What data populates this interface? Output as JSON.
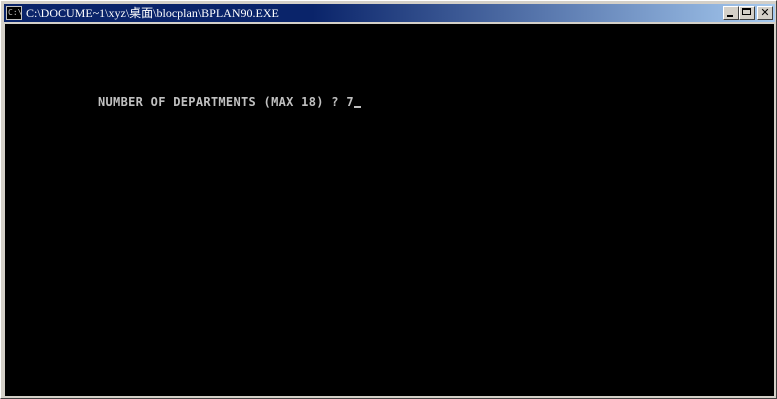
{
  "window": {
    "title": "C:\\DOCUME~1\\xyz\\桌面\\blocplan\\BPLAN90.EXE",
    "icon_name": "console-icon",
    "icon_glyph": "C:\\",
    "minimize_icon": "minimize-icon",
    "maximize_icon": "maximize-icon",
    "close_icon": "close-icon",
    "close_glyph": "✕"
  },
  "console": {
    "background": "#000000",
    "text_color": "#c0c0c0",
    "prompt": "NUMBER OF DEPARTMENTS (MAX 18) ? ",
    "input_value": "7"
  },
  "colors": {
    "titlebar_active": "#0a246a",
    "titlebar_gradient_end": "#a6caf0",
    "window_face": "#d4d0c8"
  }
}
